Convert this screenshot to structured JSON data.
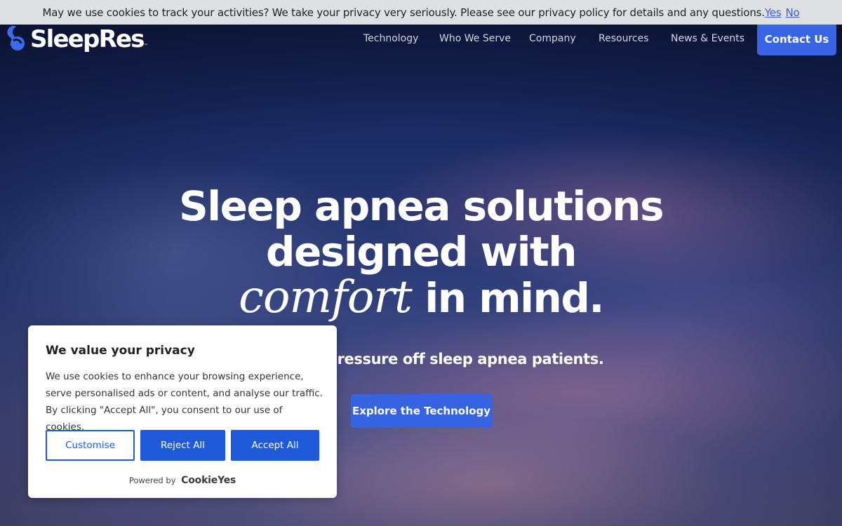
{
  "notice_bar": {
    "text": "May we use cookies to track your activities? We take your privacy very seriously. Please see our privacy policy for details and any questions.",
    "yes_label": "Yes",
    "no_label": "No"
  },
  "header": {
    "logo_text": "SleepRes",
    "logo_tm": "™",
    "nav": [
      {
        "label": "Technology"
      },
      {
        "label": "Who We Serve"
      },
      {
        "label": "Company"
      },
      {
        "label": "Resources"
      },
      {
        "label": "News & Events"
      }
    ],
    "contact_label": "Contact Us"
  },
  "hero": {
    "headline_line1": "Sleep apnea solutions",
    "headline_line2": "designed with",
    "headline_script": "comfort",
    "headline_line3_rest": " in mind.",
    "subline": "Taking the pressure off sleep apnea patients.",
    "cta_label": "Explore the Technology"
  },
  "consent": {
    "title": "We value your privacy",
    "body": "We use cookies to enhance your browsing experience, serve personalised ads or content, and analyse our traffic. By clicking \"Accept All\", you consent to our use of cookies.",
    "customise_label": "Customise",
    "reject_label": "Reject All",
    "accept_label": "Accept All",
    "powered_label": "Powered by",
    "powered_brand": "CookieYes"
  },
  "colors": {
    "accent": "#3865e6",
    "consent_button": "#1e5ad9",
    "notice_bg": "#dfe0e4"
  }
}
